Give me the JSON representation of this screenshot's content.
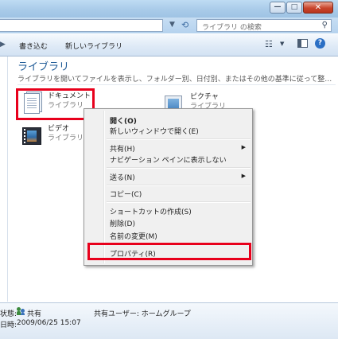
{
  "window": {
    "buttons": {
      "minimize_glyph": "—",
      "maximize_glyph": "□",
      "close_glyph": "✕"
    }
  },
  "address_bar": {
    "arrow": "▼",
    "refresh_icon": "refresh-icon",
    "search_placeholder": "ライブラリ の検索",
    "search_icon": "magnifier-icon"
  },
  "toolbar": {
    "back_arrow": "▶",
    "burn_label": "書き込む",
    "new_library_label": "新しいライブラリ",
    "help_glyph": "?"
  },
  "main": {
    "title": "ライブラリ",
    "description": "ライブラリを開いてファイルを表示し、フォルダー別、日付別、またはその他の基準に従って整…",
    "items": [
      {
        "name": "ドキュメント",
        "sub": "ライブラリ",
        "icon": "documents-icon"
      },
      {
        "name": "ピクチャ",
        "sub": "ライブラリ",
        "icon": "pictures-icon"
      },
      {
        "name": "ビデオ",
        "sub": "ライブラリ",
        "icon": "videos-icon"
      }
    ]
  },
  "context_menu": {
    "open": "開く(O)",
    "open_new_window": "新しいウィンドウで開く(E)",
    "share": "共有(H)",
    "hide_nav_pane": "ナビゲーション ペインに表示しない",
    "send_to": "送る(N)",
    "copy": "コピー(C)",
    "create_shortcut": "ショートカットの作成(S)",
    "delete": "削除(D)",
    "rename": "名前の変更(M)",
    "properties": "プロパティ(R)",
    "submenu_arrow": "▶"
  },
  "status_bar": {
    "state_label": "状態:",
    "state_value": "共有",
    "shared_users": "共有ユーザー: ホームグループ",
    "date_label": "日時:",
    "date_value": "2009/06/25 15:07"
  },
  "colors": {
    "highlight": "#e8001c",
    "title_link": "#1e5a96"
  }
}
